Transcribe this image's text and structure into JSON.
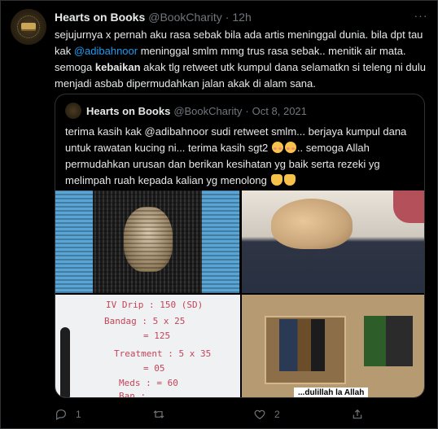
{
  "tweet": {
    "name": "Hearts on Books",
    "handle": "@BookCharity",
    "separator": "·",
    "time": "12h",
    "more": "···",
    "text_1": "sejujurnya x pernah aku rasa sebak bila ada artis meninggal dunia. bila dpt tau kak ",
    "mention": "@adibahnoor",
    "text_2": " meninggal smlm mmg trus rasa sebak.. menitik air mata. semoga ",
    "bold": "kebaikan",
    "text_3": " akak tlg retweet utk kumpul dana selamatkn si teleng ni dulu menjadi asbab dipermudahkan jalan akak di alam sana."
  },
  "quote": {
    "name": "Hearts on Books",
    "handle": "@BookCharity",
    "separator": "·",
    "date": "Oct 8, 2021",
    "text_1": "terima kasih kak @adibahnoor sudi retweet smlm... berjaya kumpul dana untuk rawatan kucing ni... terima kasih sgt2 ",
    "text_2": ".. semoga Allah permudahkan urusan dan berikan kesihatan yg baik serta rezeki yg melimpah ruah kepada kalian yg menolong ",
    "whiteboard": [
      "IV Drip : 150 (SD)",
      "Bandag : 5 x 25",
      "= 125",
      "Treatment : 5 x 35",
      "= 05",
      "Meds : = 60",
      "Ban : ..."
    ],
    "photo_caption": "...dulillah la Allah"
  },
  "actions": {
    "reply_count": "1",
    "retweet_count": "",
    "like_count": "2",
    "share_count": ""
  },
  "colors": {
    "background": "#000000",
    "text": "#e7e9ea",
    "muted": "#71767b",
    "link": "#1d9bf0",
    "border": "#2f3336"
  }
}
